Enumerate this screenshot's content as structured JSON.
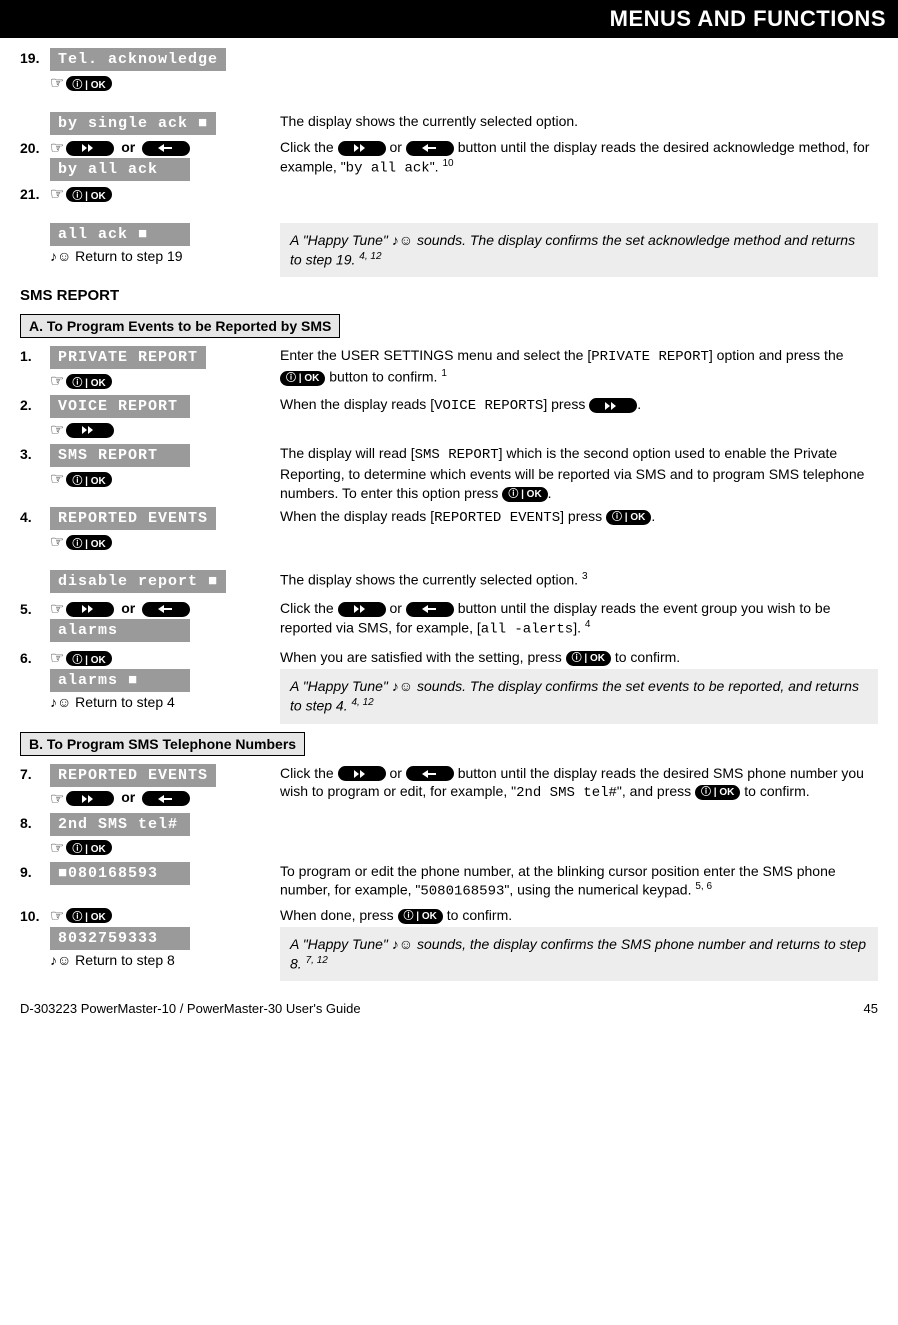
{
  "header": "MENUS AND FUNCTIONS",
  "step19": {
    "num": "19.",
    "lcd": "Tel. acknowledge"
  },
  "s19_desc": "The display shows the currently selected option.",
  "s20": {
    "num": "20.",
    "lcd_top": "by single ack  ■",
    "lcd_bot": "by all ack",
    "or": "or",
    "desc_a": "Click the ",
    "desc_b": " or ",
    "desc_c": " button until the display reads the desired acknowledge method, for example, \"",
    "code": "by all ack",
    "desc_d": "\". ",
    "sup": "10"
  },
  "s21": {
    "num": "21."
  },
  "s21b": {
    "lcd": "all ack     ■",
    "return": "♪☺ Return to step 19",
    "note_a": "A \"Happy Tune\" ♪☺ sounds. The display confirms the set acknowledge method and returns to step 1",
    "note_b": "9. ",
    "sup": "4, 12"
  },
  "sms_report_title": "SMS REPORT",
  "sub_a": "A. To Program Events to be Reported by SMS",
  "a1": {
    "num": "1.",
    "lcd": "PRIVATE REPORT",
    "t1": "Enter the USER SETTINGS menu and select the [",
    "code": "PRIVATE REPORT",
    "t2": "] option and press the ",
    "t3": " button to confirm. ",
    "sup": "1"
  },
  "a2": {
    "num": "2.",
    "lcd": "VOICE REPORT",
    "t1": "When the display reads [",
    "code": "VOICE REPORTS",
    "t2": "] press ",
    "t3": "."
  },
  "a3": {
    "num": "3.",
    "lcd": "SMS REPORT",
    "t1": "The display will read [",
    "code": "SMS REPORT",
    "t2": "] which is the second option used to enable the Private Reporting, to determine which events will be reported via SMS and to program SMS telephone numbers. To enter this option press ",
    "t3": "."
  },
  "a4": {
    "num": "4.",
    "lcd": "REPORTED EVENTS",
    "t1": "When the display reads [",
    "code": "REPORTED EVENTS",
    "t2": "] press ",
    "t3": "."
  },
  "a4b": {
    "lcd": "disable report ■",
    "t1": "The display shows the currently selected option. ",
    "sup": "3"
  },
  "a5": {
    "num": "5.",
    "or": "or",
    "lcd_bot": "alarms",
    "t1": "Click the ",
    "t2": " or ",
    "t3": " button until the display reads the event group you wish to be reported via SMS, for example, [",
    "code": "all -alerts",
    "t4": "]. ",
    "sup": "4"
  },
  "a6": {
    "num": "6.",
    "lcd": "alarms     ■",
    "t1": "When you are satisfied with the setting, press ",
    "t2": " to confirm.",
    "note": "A \"Happy Tune\" ♪☺ sounds. The display confirms the set events to be reported, and returns to step 4",
    "note2": ". ",
    "sup": "4, 12",
    "return": "♪☺ Return to step 4"
  },
  "sub_b": "B. To Program SMS Telephone Numbers",
  "b7": {
    "num": "7.",
    "lcd": "REPORTED EVENTS",
    "or": "or",
    "t1": "Click the ",
    "t2": " or ",
    "t3": " button until the display reads the desired SMS phone number you wish to program or edit, for example, \"",
    "code": "2nd SMS tel#",
    "t4": "\", and press ",
    "t5": " to confirm."
  },
  "b8": {
    "num": "8.",
    "lcd": "2nd SMS tel#"
  },
  "b9": {
    "num": "9.",
    "lcd": "■080168593",
    "t1": "To program or edit the phone number, at the blinking cursor position enter the SMS phone number, for example, \"",
    "code": "5080168593",
    "t2": "\", using the numerical keypad. ",
    "sup": "5, 6"
  },
  "b10": {
    "num": "10.",
    "lcd": "8032759333",
    "t1": "When done, press ",
    "t2": " to confirm.",
    "note": "A \"Happy Tune\" ♪☺ sounds, the display confirms the SMS phone number and returns to step 8. ",
    "sup": "7, 12",
    "return": "♪☺ Return to step 8"
  },
  "footer": {
    "left": "D-303223 PowerMaster-10 / PowerMaster-30 User's Guide",
    "right": "45"
  }
}
